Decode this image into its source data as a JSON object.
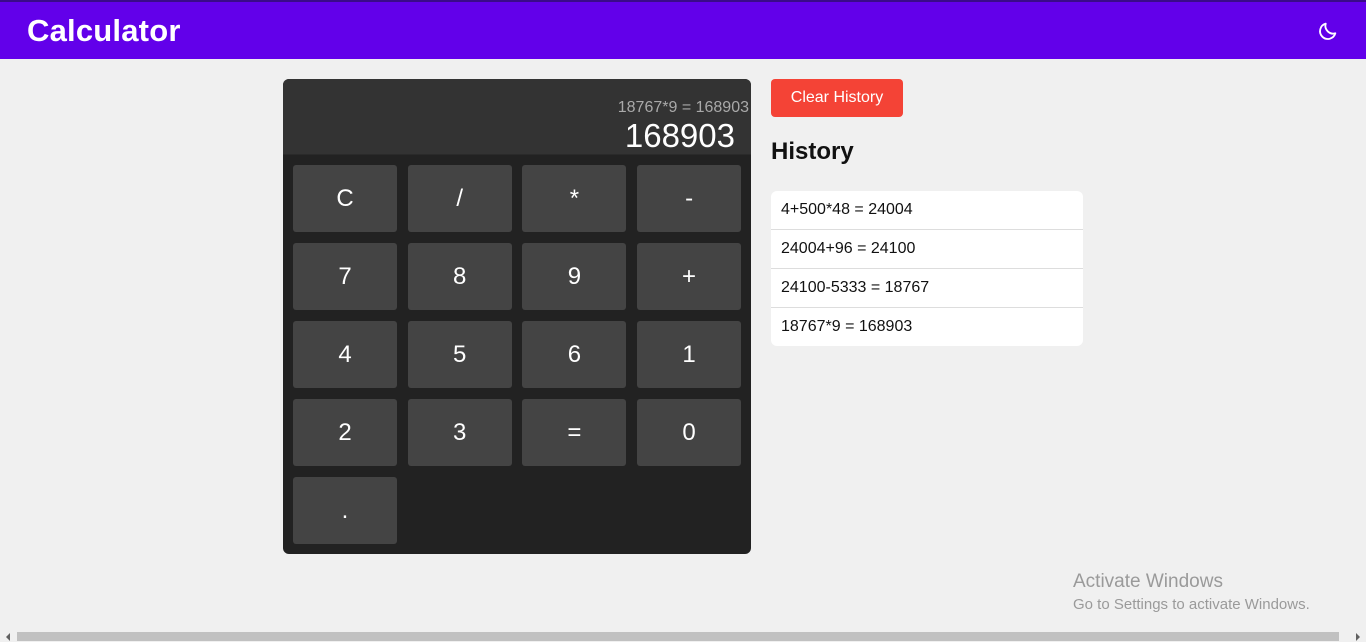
{
  "header": {
    "title": "Calculator",
    "theme_icon": "moon-icon"
  },
  "calculator": {
    "expression": "18767*9 = 168903",
    "value": "168903",
    "keys": [
      "C",
      "/",
      "*",
      "-",
      "7",
      "8",
      "9",
      "+",
      "4",
      "5",
      "6",
      "1",
      "2",
      "3",
      "=",
      "0",
      "."
    ]
  },
  "history": {
    "clear_label": "Clear History",
    "heading": "History",
    "items": [
      "4+500*48 = 24004",
      "24004+96 = 24100",
      "24100-5333 = 18767",
      "18767*9 = 168903"
    ]
  },
  "watermark": {
    "title": "Activate Windows",
    "subtitle": "Go to Settings to activate Windows."
  },
  "colors": {
    "header": "#6200ea",
    "clear_button": "#f44336",
    "calculator_bg": "#222222",
    "key_bg": "#444444"
  }
}
